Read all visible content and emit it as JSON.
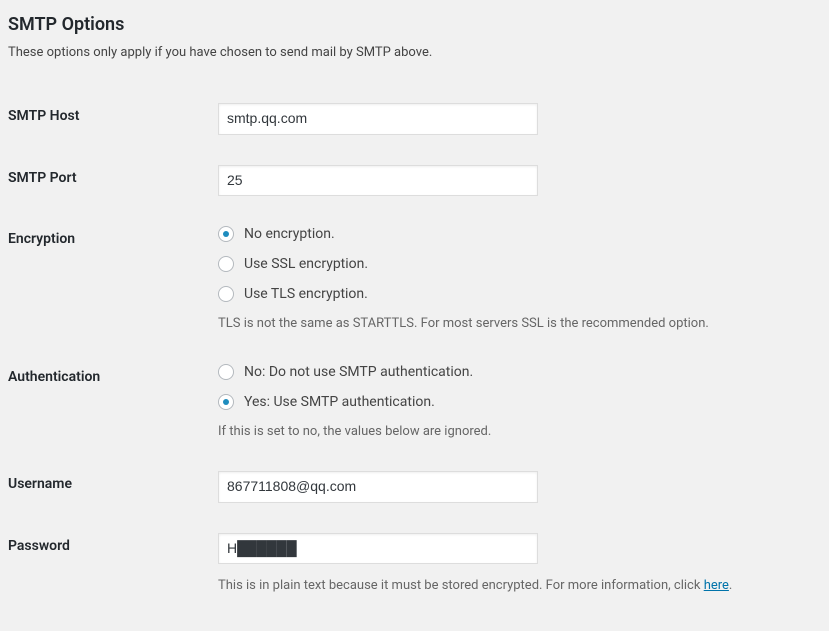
{
  "title": "SMTP Options",
  "subtitle": "These options only apply if you have chosen to send mail by SMTP above.",
  "fields": {
    "smtp_host": {
      "label": "SMTP Host",
      "value": "smtp.qq.com"
    },
    "smtp_port": {
      "label": "SMTP Port",
      "value": "25"
    },
    "encryption": {
      "label": "Encryption",
      "options": {
        "none": "No encryption.",
        "ssl": "Use SSL encryption.",
        "tls": "Use TLS encryption."
      },
      "selected": "none",
      "description": "TLS is not the same as STARTTLS. For most servers SSL is the recommended option."
    },
    "authentication": {
      "label": "Authentication",
      "options": {
        "no": "No: Do not use SMTP authentication.",
        "yes": "Yes: Use SMTP authentication."
      },
      "selected": "yes",
      "description": "If this is set to no, the values below are ignored."
    },
    "username": {
      "label": "Username",
      "value": "867711808@qq.com"
    },
    "password": {
      "label": "Password",
      "value": "H██████",
      "description_prefix": "This is in plain text because it must be stored encrypted. For more information, click ",
      "description_link": "here",
      "description_suffix": "."
    }
  }
}
